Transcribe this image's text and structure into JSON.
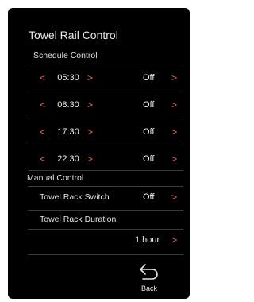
{
  "title": "Towel Rail Control",
  "schedule": {
    "label": "Schedule Control",
    "rows": [
      {
        "time": "05:30",
        "state": "Off"
      },
      {
        "time": "08:30",
        "state": "Off"
      },
      {
        "time": "17:30",
        "state": "Off"
      },
      {
        "time": "22:30",
        "state": "Off"
      }
    ]
  },
  "manual": {
    "label": "Manual Control",
    "switch_label": "Towel Rack Switch",
    "switch_state": "Off",
    "duration_label": "Towel Rack Duration",
    "duration_value": "1 hour"
  },
  "back_label": "Back",
  "arrows": {
    "left": "<",
    "right": ">"
  },
  "colors": {
    "accent": "#e86a3a",
    "background": "#000000",
    "text": "#e6e6e6"
  }
}
